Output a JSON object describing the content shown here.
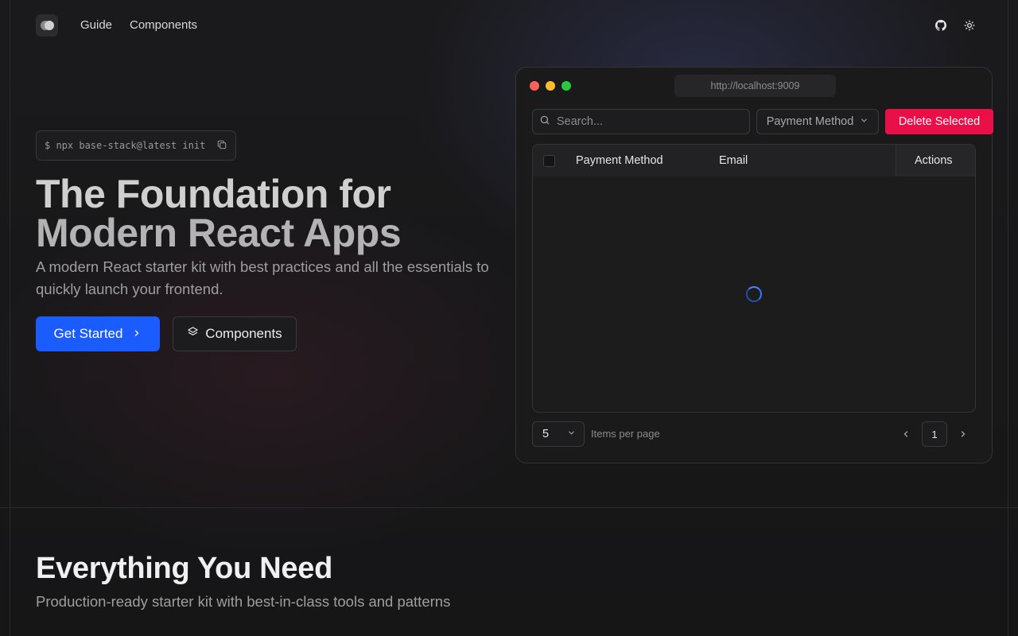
{
  "nav": {
    "links": [
      "Guide",
      "Components"
    ],
    "icons": [
      "github-icon",
      "sun-icon"
    ]
  },
  "hero": {
    "command": "$ npx base-stack@latest init",
    "title_line1": "The Foundation for",
    "title_line2": "Modern React Apps",
    "subtitle": "A modern React starter kit with best practices and all the essentials to quickly launch your frontend.",
    "primary_button": "Get Started",
    "secondary_button": "Components"
  },
  "preview": {
    "url": "http://localhost:9009",
    "search_placeholder": "Search...",
    "filter_label": "Payment Method",
    "delete_label": "Delete Selected",
    "columns": [
      "Payment Method",
      "Email",
      "Actions"
    ],
    "per_page_value": "5",
    "per_page_label": "Items per page",
    "current_page": "1"
  },
  "features": {
    "title": "Everything You Need",
    "subtitle": "Production-ready starter kit with best-in-class tools and patterns"
  },
  "colors": {
    "accent": "#1a5cff",
    "danger": "#ea0f46",
    "background": "#141414"
  }
}
